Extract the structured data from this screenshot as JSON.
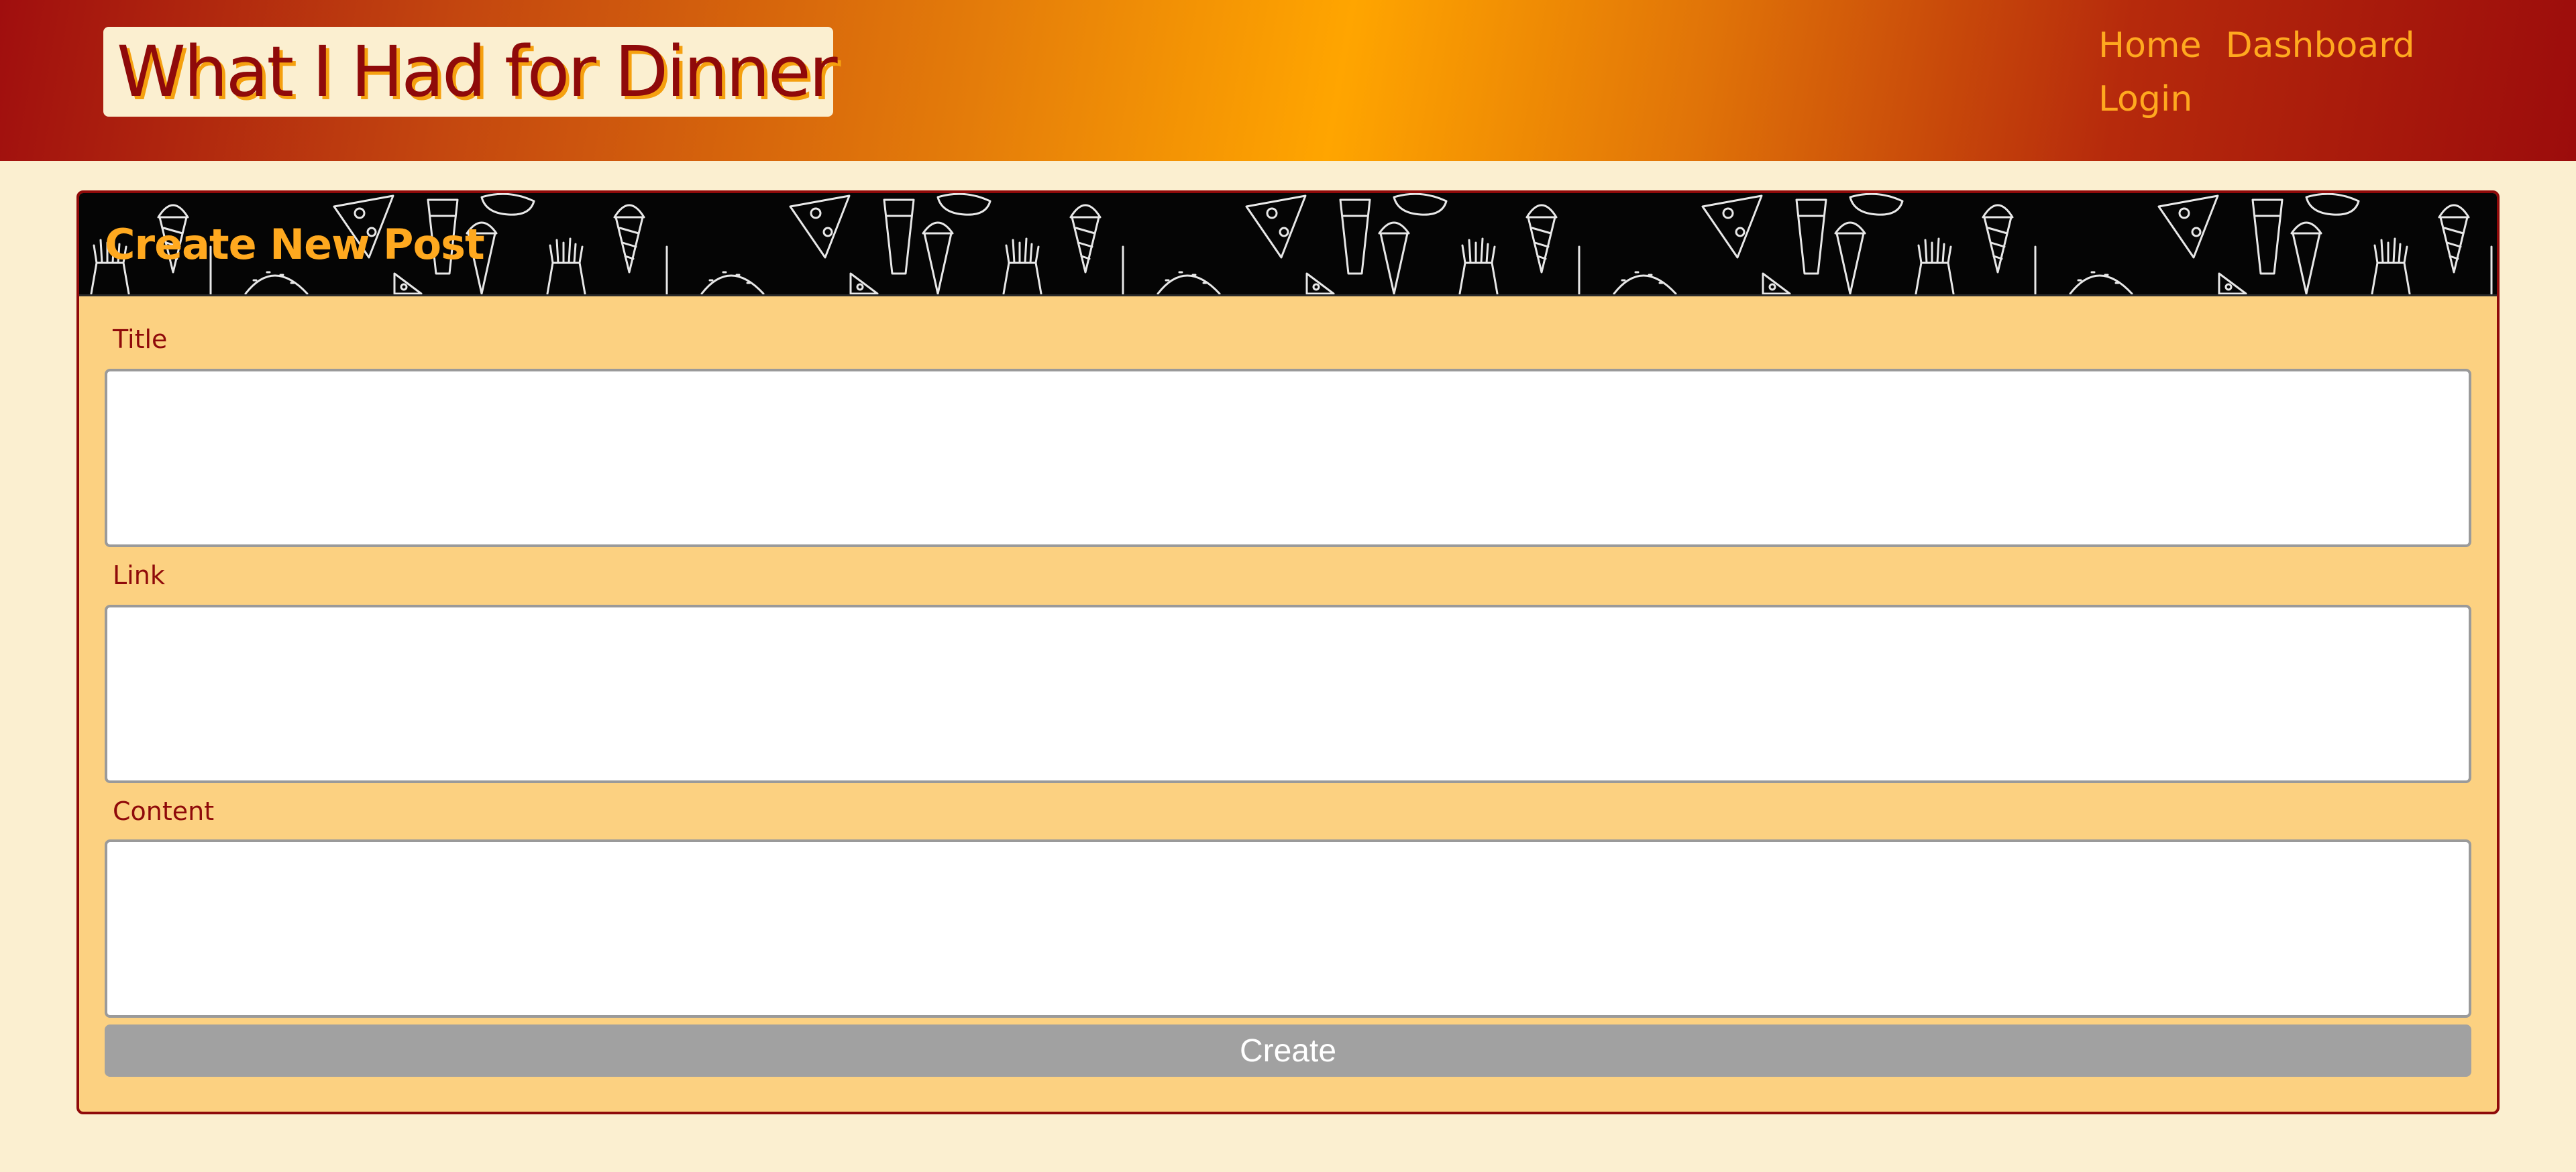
{
  "header": {
    "site_title": "What I Had for Dinner",
    "nav": [
      {
        "label": "Home"
      },
      {
        "label": "Dashboard"
      },
      {
        "label": "Login"
      }
    ]
  },
  "form": {
    "heading": "Create New Post",
    "fields": [
      {
        "label": "Title",
        "value": "",
        "placeholder": ""
      },
      {
        "label": "Link",
        "value": "",
        "placeholder": ""
      },
      {
        "label": "Content",
        "value": "",
        "placeholder": ""
      }
    ],
    "submit_label": "Create"
  },
  "colors": {
    "page_background": "#fbefd0",
    "brand_dark_red": "#8f0a0a",
    "brand_orange": "#ffa91f",
    "card_background": "#fcd181",
    "button_gray": "#a1a1a1"
  },
  "icons": [
    "food-pattern-banner"
  ]
}
